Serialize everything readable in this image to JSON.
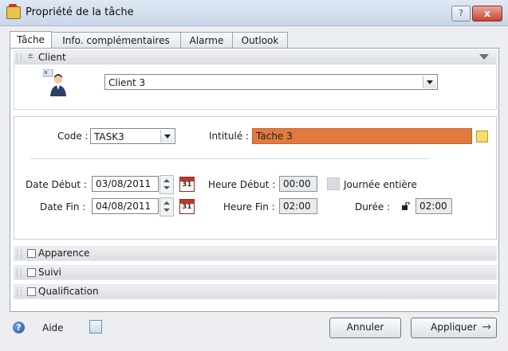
{
  "window": {
    "title": "Propriété de la tâche",
    "help_glyph": "?",
    "close_glyph": "x"
  },
  "tabs": [
    {
      "label": "Tâche",
      "active": true
    },
    {
      "label": "Info. complémentaires",
      "active": false
    },
    {
      "label": "Alarme",
      "active": false
    },
    {
      "label": "Outlook",
      "active": false
    }
  ],
  "client_section": {
    "label": "Client",
    "collapse_glyph": "±",
    "selected_client": "Client 3"
  },
  "task": {
    "code_label": "Code :",
    "code_value": "TASK3",
    "intitule_label": "Intitulé :",
    "intitule_value": "Tache 3",
    "date_debut_label": "Date Début :",
    "date_debut_value": "03/08/2011",
    "date_fin_label": "Date Fin :",
    "date_fin_value": "04/08/2011",
    "heure_debut_label": "Heure Début :",
    "heure_debut_value": "00:00",
    "heure_fin_label": "Heure Fin :",
    "heure_fin_value": "02:00",
    "journee_label": "Journée entière",
    "duree_label": "Durée :",
    "duree_value": "02:00",
    "calendar_glyph": "31",
    "accent_color": "#e17a3e"
  },
  "sections": [
    {
      "label": "Apparence"
    },
    {
      "label": "Suivi"
    },
    {
      "label": "Qualification"
    }
  ],
  "footer": {
    "help_glyph": "?",
    "help_label": "Aide",
    "cancel_label": "Annuler",
    "apply_label": "Appliquer"
  }
}
